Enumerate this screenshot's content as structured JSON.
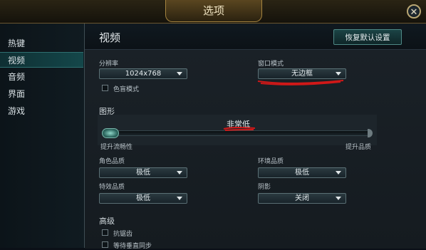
{
  "window": {
    "title": "选项",
    "close_label": "✕"
  },
  "sidebar": {
    "items": [
      {
        "label": "热键",
        "active": false
      },
      {
        "label": "视频",
        "active": true
      },
      {
        "label": "音频",
        "active": false
      },
      {
        "label": "界面",
        "active": false
      },
      {
        "label": "游戏",
        "active": false
      }
    ]
  },
  "main": {
    "title": "视频",
    "reset_label": "恢复默认设置",
    "resolution": {
      "label": "分辨率",
      "value": "1024x768"
    },
    "window_mode": {
      "label": "窗口模式",
      "value": "无边框"
    },
    "colorblind": {
      "label": "色盲模式",
      "checked": false
    },
    "graphics": {
      "section_label": "图形",
      "level_value": "非常低",
      "left_label": "提升流畅性",
      "right_label": "提升品质",
      "level_fraction": 0.0
    },
    "character_quality": {
      "label": "角色品质",
      "value": "极低"
    },
    "environment_quality": {
      "label": "环境品质",
      "value": "极低"
    },
    "effects_quality": {
      "label": "特效品质",
      "value": "极低"
    },
    "shadows": {
      "label": "阴影",
      "value": "关闭"
    },
    "advanced": {
      "section_label": "高级",
      "antialias_label": "抗锯齿",
      "vsync_label": "等待垂直同步"
    }
  },
  "colors": {
    "accent": "#1b4345",
    "annotation": "#d01818"
  }
}
